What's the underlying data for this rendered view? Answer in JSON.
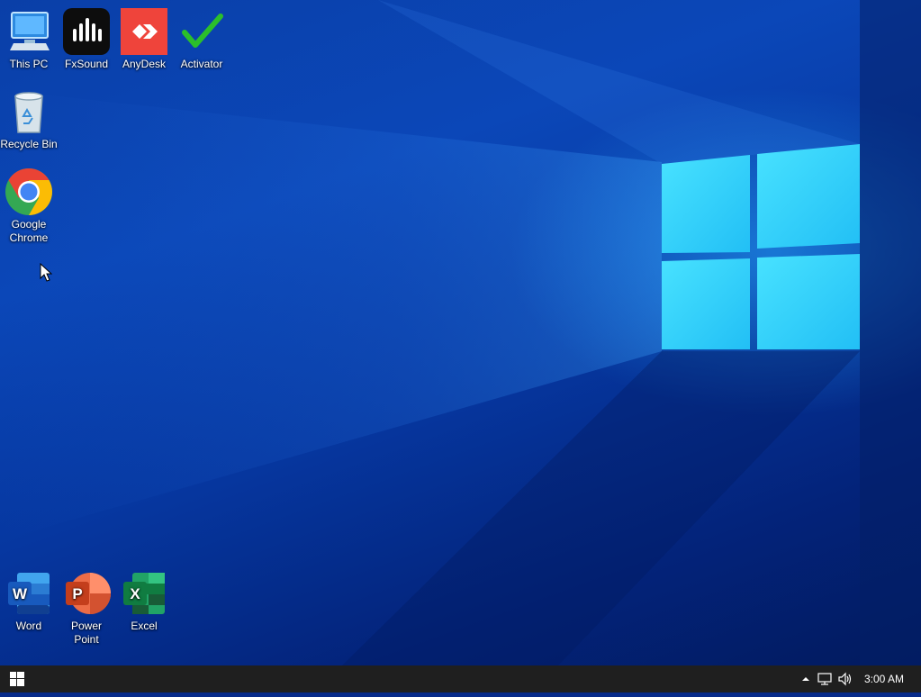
{
  "desktop": {
    "icons": [
      {
        "label": "This PC",
        "icon": "computer-icon"
      },
      {
        "label": "FxSound",
        "icon": "fxsound-icon"
      },
      {
        "label": "AnyDesk",
        "icon": "anydesk-icon"
      },
      {
        "label": "Activator",
        "icon": "checkmark-icon"
      },
      {
        "label": "Recycle Bin",
        "icon": "recycle-bin-icon"
      },
      {
        "label": "Google\nChrome",
        "icon": "chrome-icon"
      },
      {
        "label": "Word",
        "icon": "word-icon"
      },
      {
        "label": "Power\nPoint",
        "icon": "powerpoint-icon"
      },
      {
        "label": "Excel",
        "icon": "excel-icon"
      }
    ]
  },
  "taskbar": {
    "start_icon": "windows-logo-icon",
    "tray": {
      "chevron_icon": "chevron-up-icon",
      "network_icon": "network-icon",
      "volume_icon": "volume-icon",
      "clock": "3:00 AM"
    }
  },
  "colors": {
    "wallpaper": "#0a3fa8",
    "window_glow": "#3fd8ff",
    "taskbar": "#1f1f1f"
  }
}
